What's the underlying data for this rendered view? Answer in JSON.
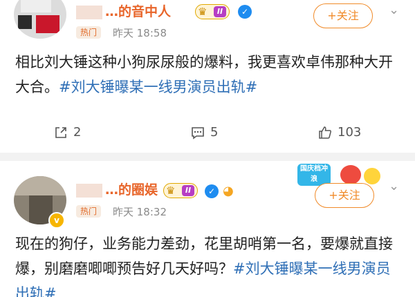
{
  "posts": [
    {
      "author_name": "…的音中人",
      "level_number": "II",
      "hot_tag": "热门",
      "time": "昨天 18:58",
      "follow_label": "+关注",
      "text_plain": "相比刘大锤这种小狗尿尿般的爆料，我更喜欢卓伟那种大开大合。",
      "topic": "#刘大锤曝某一线男演员出轨#",
      "shares": "2",
      "comments": "5",
      "likes": "103"
    },
    {
      "author_name": "…的圈娱",
      "level_number": "II",
      "hot_tag": "热门",
      "time": "昨天 18:32",
      "follow_label": "+关注",
      "promo_text": "国庆档冲浪",
      "text_plain": "现在的狗仔，业务能力差劲，花里胡哨第一名，要爆就直接爆，别磨磨唧唧预告好几天好吗？",
      "topic": "#刘大锤曝某一线男演员出轨#"
    }
  ],
  "colors": {
    "accent_orange": "#f08a28",
    "topic_blue": "#2f6fb6",
    "name_orange": "#e8652a"
  },
  "icons": {
    "share": "share-icon",
    "comment": "comment-icon",
    "like": "thumbs-up-icon",
    "more": "chevron-down-icon"
  }
}
